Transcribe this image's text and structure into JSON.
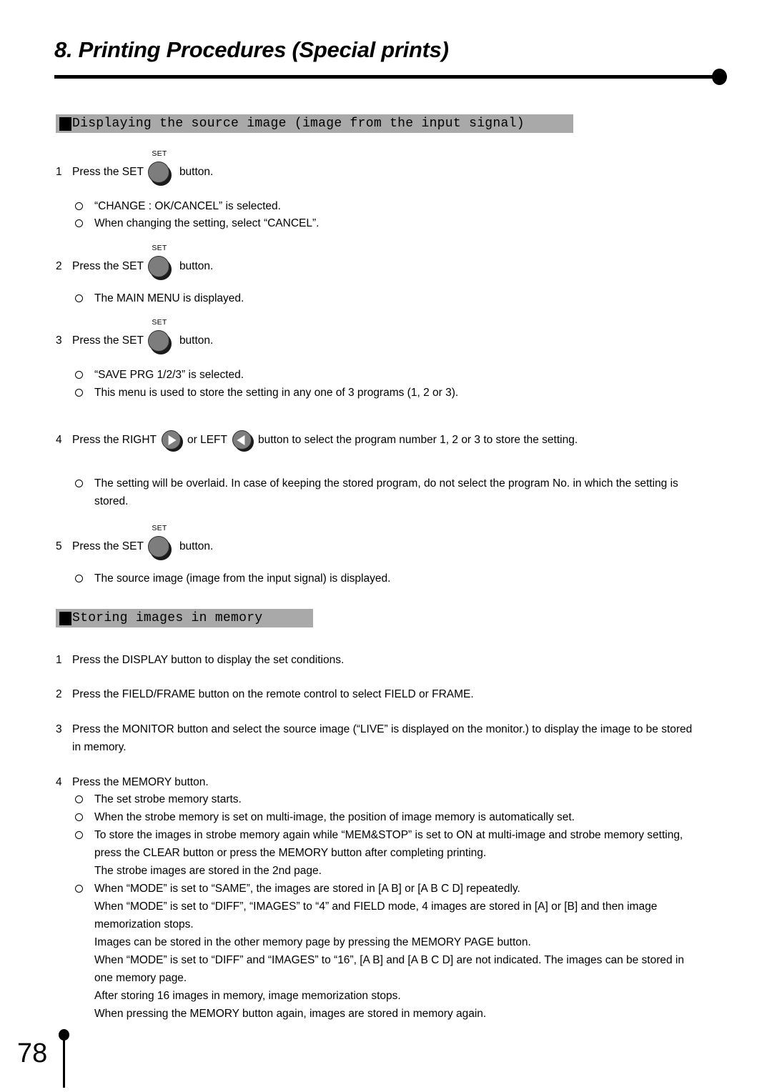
{
  "header": {
    "chapter_title": "8. Printing Procedures (Special prints)"
  },
  "sections": [
    {
      "bar_label": "Displaying the source image (image from the input signal)",
      "steps": [
        {
          "number": "1",
          "text_before": "Press the SET",
          "button": {
            "type": "knob",
            "label": "SET"
          },
          "text_after": "button.",
          "bullets": [
            "“CHANGE    : OK/CANCEL” is selected.",
            "When changing the setting, select “CANCEL”."
          ]
        },
        {
          "number": "2",
          "text_before": "Press the SET",
          "button": {
            "type": "knob",
            "label": "SET"
          },
          "text_after": "button.",
          "bullets": [
            "The MAIN MENU is displayed."
          ]
        },
        {
          "number": "3",
          "text_before": "Press the SET",
          "button": {
            "type": "knob",
            "label": "SET"
          },
          "text_after": "button.",
          "bullets": [
            "“SAVE PRG 1/2/3” is selected.",
            "This menu is used to store the setting in any one of 3 programs (1, 2 or 3)."
          ]
        },
        {
          "number": "4",
          "text_before": "Press the  RIGHT",
          "mid_text": "or LEFT",
          "text_after": "button to select the program number 1, 2 or 3 to store the setting.",
          "bullets_wrapped": [
            {
              "line1": "The setting will be overlaid.  In case of keeping the stored program, do not select the program No. in which the setting is",
              "line2": "stored."
            }
          ]
        },
        {
          "number": "5",
          "text_before": "Press the SET",
          "button": {
            "type": "knob",
            "label": "SET"
          },
          "text_after": "button.",
          "bullets": [
            "The source image (image from the input signal) is displayed."
          ]
        }
      ]
    },
    {
      "bar_label": "Storing images in memory",
      "mem_steps": [
        {
          "number": "1",
          "lines": [
            "Press the DISPLAY button to display the set conditions."
          ]
        },
        {
          "number": "2",
          "lines": [
            "Press the FIELD/FRAME button on the remote control to select FIELD or FRAME."
          ]
        },
        {
          "number": "3",
          "lines": [
            "Press the MONITOR button and select the source image (“LIVE” is displayed on the monitor.) to display the image to be stored",
            "in memory."
          ]
        },
        {
          "number": "4",
          "lines": [
            "Press the MEMORY button."
          ]
        }
      ],
      "mem_bullets": [
        {
          "lines": [
            "The set strobe memory starts."
          ]
        },
        {
          "lines": [
            "When the strobe memory is set on multi-image, the position of image memory is automatically set."
          ]
        },
        {
          "lines": [
            "To store the images in strobe memory again while “MEM&STOP” is set to ON at multi-image and strobe memory setting,",
            "press the CLEAR button or press the MEMORY button after completing printing.",
            "The strobe images are stored in the 2nd page."
          ]
        },
        {
          "lines": [
            "When “MODE” is set to “SAME”, the images are stored in [A B] or [A B C D] repeatedly.",
            "When “MODE” is set to “DIFF”, “IMAGES” to “4” and FIELD mode, 4 images are stored in [A] or [B] and then image",
            "memorization stops.",
            "Images can be stored in the other memory page by pressing the MEMORY PAGE button.",
            "When “MODE” is set to “DIFF” and “IMAGES” to “16”, [A B] and [A B C D] are not indicated.  The images can be stored in",
            "one memory page.",
            "After storing 16 images in memory, image memorization stops.",
            "When pressing the MEMORY button again, images are stored in memory again."
          ]
        }
      ]
    }
  ],
  "footer": {
    "page_number": "78"
  },
  "colors": {
    "section_bar_gray": "#a9a9a9",
    "knob_gray": "#7d7d7d",
    "ink": "#000000"
  }
}
